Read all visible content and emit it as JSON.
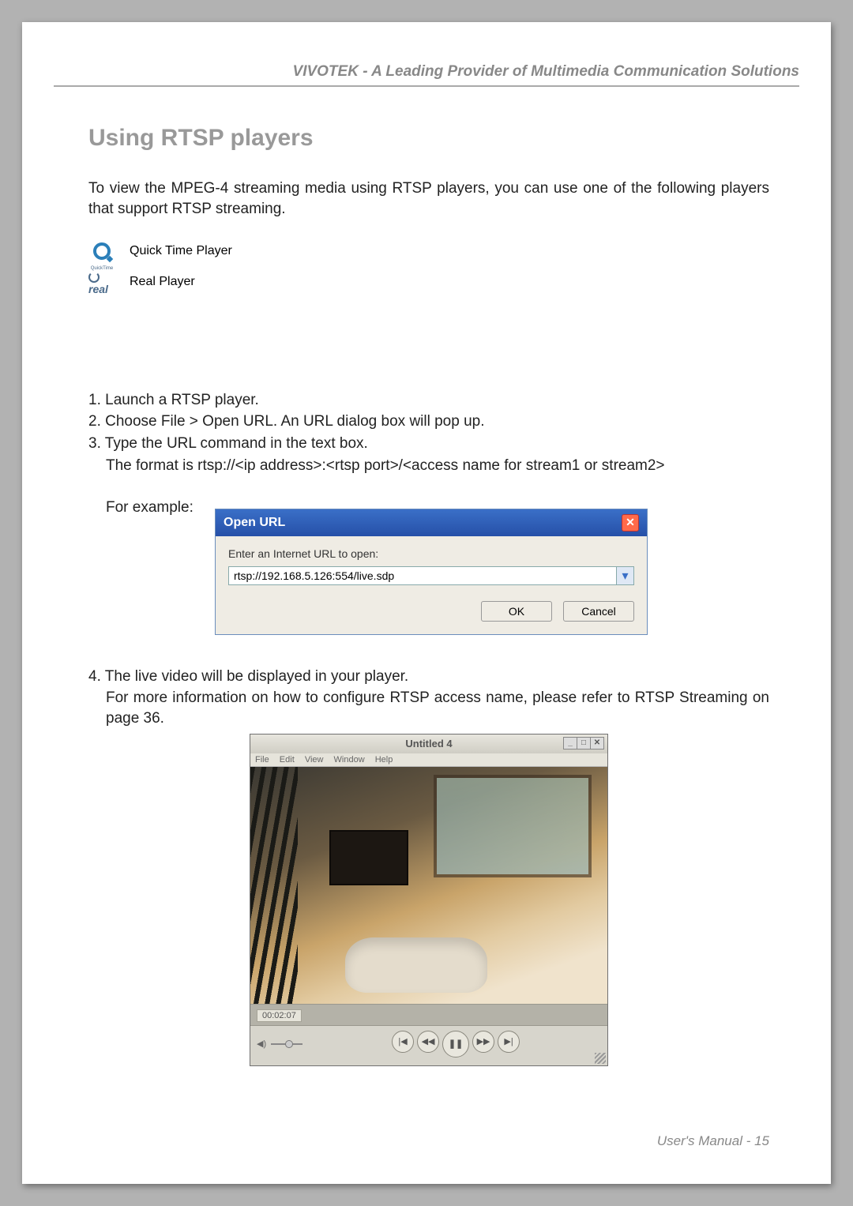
{
  "header": {
    "tagline": "VIVOTEK - A Leading Provider of Multimedia Communication Solutions"
  },
  "section": {
    "title": "Using RTSP players",
    "intro": "To view the MPEG-4 streaming media using RTSP players, you can use one of the following players that support RTSP streaming."
  },
  "players": {
    "quicktime": "Quick Time Player",
    "quicktime_caption": "QuickTime",
    "real": "Real Player",
    "real_label": "real"
  },
  "steps": {
    "s1": "1. Launch a RTSP player.",
    "s2": "2. Choose File > Open URL. An URL dialog box will pop up.",
    "s3": "3. Type the URL command in the text box.",
    "s3b": "The format is rtsp://<ip address>:<rtsp port>/<access name for stream1 or stream2>",
    "example_label": "For example:",
    "s4": "4. The live video will be displayed in your player.",
    "s4b": "For more information on how to configure RTSP access name, please refer to RTSP Streaming on page 36."
  },
  "dialog": {
    "title": "Open URL",
    "prompt": "Enter an Internet URL to open:",
    "value": "rtsp://192.168.5.126:554/live.sdp",
    "ok": "OK",
    "cancel": "Cancel"
  },
  "player_window": {
    "title": "Untitled 4",
    "menu": {
      "file": "File",
      "edit": "Edit",
      "view": "View",
      "window": "Window",
      "help": "Help"
    },
    "time": "00:02:07"
  },
  "footer": {
    "label": "User's Manual - 15"
  }
}
